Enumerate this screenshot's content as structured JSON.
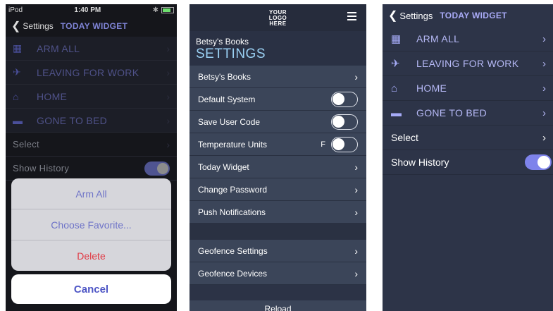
{
  "panel1": {
    "status": {
      "carrier": "iPod",
      "time": "1:40 PM"
    },
    "nav": {
      "back_label": "Settings",
      "title": "TODAY WIDGET"
    },
    "items": [
      {
        "label": "ARM ALL",
        "icon": "arm-all-icon"
      },
      {
        "label": "LEAVING FOR WORK",
        "icon": "leaving-icon"
      },
      {
        "label": "HOME",
        "icon": "home-icon"
      },
      {
        "label": "GONE TO BED",
        "icon": "bed-icon"
      }
    ],
    "select_label": "Select",
    "show_history_label": "Show History",
    "show_history_on": true,
    "action_sheet": {
      "options": [
        "Arm All",
        "Choose Favorite...",
        "Delete"
      ],
      "cancel": "Cancel"
    }
  },
  "panel2": {
    "logo": [
      "YOUR",
      "LOGO",
      "HERE"
    ],
    "subtitle": "Betsy's Books",
    "title": "SETTINGS",
    "rows": {
      "betsys_books": "Betsy's Books",
      "default_system": "Default System",
      "save_user_code": "Save User Code",
      "temperature_units": "Temperature Units",
      "temperature_value": "F",
      "today_widget": "Today Widget",
      "change_password": "Change Password",
      "push_notifications": "Push Notifications",
      "geofence_settings": "Geofence Settings",
      "geofence_devices": "Geofence Devices"
    },
    "reload": "Reload"
  },
  "panel3": {
    "nav": {
      "back_label": "Settings",
      "title": "TODAY WIDGET"
    },
    "items": [
      {
        "label": "ARM ALL",
        "icon": "arm-all-icon"
      },
      {
        "label": "LEAVING FOR WORK",
        "icon": "leaving-icon"
      },
      {
        "label": "HOME",
        "icon": "home-icon"
      },
      {
        "label": "GONE TO BED",
        "icon": "bed-icon"
      }
    ],
    "select_label": "Select",
    "show_history_label": "Show History",
    "show_history_on": true
  },
  "colors": {
    "accent": "#7e83eb",
    "danger": "#e03a44",
    "link": "#4d55c5"
  }
}
